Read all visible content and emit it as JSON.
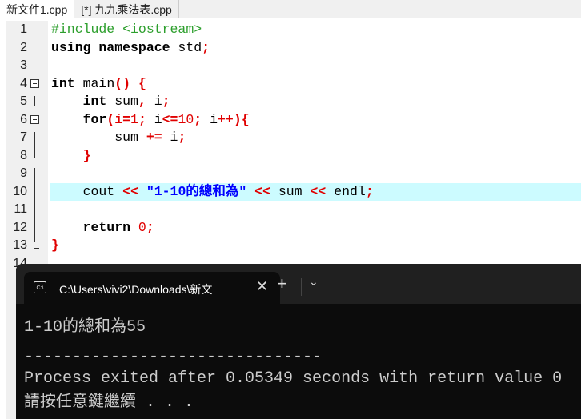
{
  "tabs": [
    {
      "label": "新文件1.cpp",
      "active": true
    },
    {
      "label": "[*] 九九乘法表.cpp",
      "active": false
    }
  ],
  "code": {
    "lines": [
      "1",
      "2",
      "3",
      "4",
      "5",
      "6",
      "7",
      "8",
      "9",
      "10",
      "11",
      "12",
      "13",
      "14"
    ],
    "l1a": "#include <iostream>",
    "l2a": "using namespace",
    "l2b": " std",
    "l2c": ";",
    "l4a": "int",
    "l4b": " main",
    "l4c": "() {",
    "l5a": "    int",
    "l5b": " sum",
    "l5c": ",",
    "l5d": " i",
    "l5e": ";",
    "l6a": "    for",
    "l6b": "(i",
    "l6c": "=",
    "l6d": "1",
    "l6e": ";",
    "l6f": " i",
    "l6g": "<=",
    "l6h": "10",
    "l6i": ";",
    "l6j": " i",
    "l6k": "++){",
    "l7a": "        sum ",
    "l7b": "+=",
    "l7c": " i",
    "l7d": ";",
    "l8a": "    }",
    "l10a": "    cout ",
    "l10b": "<<",
    "l10c": " \"1-10的總和為\" ",
    "l10d": "<<",
    "l10e": " sum ",
    "l10f": "<<",
    "l10g": " endl",
    "l10h": ";",
    "l12a": "    return",
    "l12b": " 0",
    "l12c": ";",
    "l13a": "}",
    "highlight_line": "10",
    "highlight_color": "#ccfbff"
  },
  "terminal": {
    "tab_title": "C:\\Users\\vivi2\\Downloads\\新文",
    "tab_icon": "terminal-icon",
    "new_tab": "+",
    "dropdown": "⌄",
    "close": "✕",
    "output": [
      "1-10的總和為55",
      "",
      "-------------------------------",
      "Process exited after 0.05349 seconds with return value 0",
      "請按任意鍵繼續 . . ."
    ]
  }
}
